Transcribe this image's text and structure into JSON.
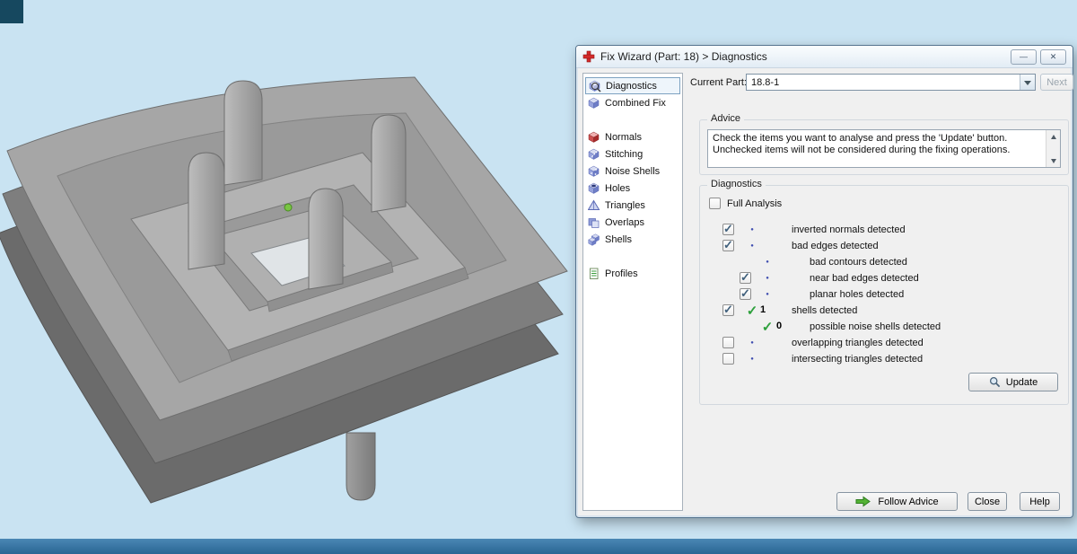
{
  "window": {
    "title": "Fix Wizard (Part: 18) > Diagnostics",
    "controls": {
      "minimize": "—",
      "close": "✕"
    }
  },
  "colors": {
    "viewport_background": "#c9e3f2",
    "taskbar_blue": "#2f6f9e",
    "marker_green": "#79c544",
    "status_bullet_blue": "#3f4db0",
    "status_check_green": "#2da03c"
  },
  "sidebar": {
    "selected": "Diagnostics",
    "items": [
      {
        "label": "Diagnostics"
      },
      {
        "label": "Combined Fix"
      },
      {
        "label": "Normals"
      },
      {
        "label": "Stitching"
      },
      {
        "label": "Noise Shells"
      },
      {
        "label": "Holes"
      },
      {
        "label": "Triangles"
      },
      {
        "label": "Overlaps"
      },
      {
        "label": "Shells"
      },
      {
        "label": "Profiles"
      }
    ]
  },
  "header": {
    "current_part_label": "Current Part:",
    "current_part_value": "18.8-1",
    "next_button": "Next"
  },
  "advice": {
    "title": "Advice",
    "text": "Check the items you want to analyse and press the 'Update' button. Unchecked items will not be considered during the fixing operations."
  },
  "diagnostics": {
    "title": "Diagnostics",
    "full_analysis": {
      "label": "Full Analysis",
      "state": "unchecked"
    },
    "rows": [
      {
        "label": "inverted normals detected",
        "checkbox": "checked",
        "status": "bullet",
        "count": ""
      },
      {
        "label": "bad edges detected",
        "checkbox": "checked",
        "status": "bullet",
        "count": ""
      },
      {
        "label": "bad contours detected",
        "checkbox": "none",
        "status": "bullet",
        "count": ""
      },
      {
        "label": "near bad edges detected",
        "checkbox": "checked",
        "status": "bullet",
        "count": ""
      },
      {
        "label": "planar holes detected",
        "checkbox": "checked",
        "status": "bullet",
        "count": ""
      },
      {
        "label": "shells detected",
        "checkbox": "checked",
        "status": "check",
        "count": "1"
      },
      {
        "label": "possible noise shells detected",
        "checkbox": "none",
        "status": "check",
        "count": "0"
      },
      {
        "label": "overlapping triangles detected",
        "checkbox": "unchecked",
        "status": "bullet",
        "count": ""
      },
      {
        "label": "intersecting triangles detected",
        "checkbox": "unchecked",
        "status": "bullet",
        "count": ""
      }
    ],
    "update_button": "Update"
  },
  "footer": {
    "follow_advice_button": "Follow Advice",
    "close_button": "Close",
    "help_button": "Help"
  }
}
